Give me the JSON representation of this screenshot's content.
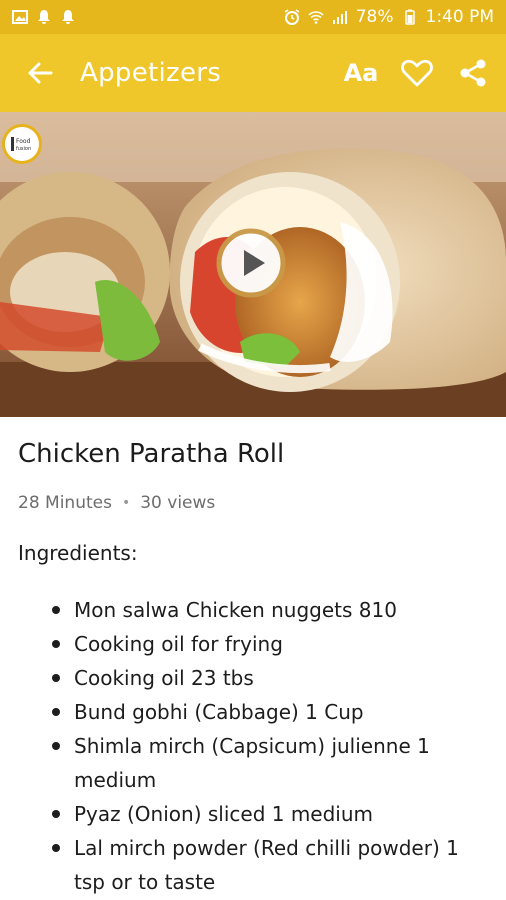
{
  "status_bar": {
    "battery": "78%",
    "time": "1:40 PM"
  },
  "app_bar": {
    "title": "Appetizers",
    "font_size_label": "Aa"
  },
  "hero": {
    "logo_text": "Food Fusion"
  },
  "recipe": {
    "title": "Chicken Paratha Roll",
    "duration": "28 Minutes",
    "views": "30 views",
    "ingredients_heading": "Ingredients:",
    "ingredients": [
      "Mon salwa Chicken nuggets 810",
      "Cooking oil for frying",
      "Cooking oil 23 tbs",
      "Bund gobhi (Cabbage) 1 Cup",
      "Shimla mirch (Capsicum) julienne 1 medium",
      "Pyaz (Onion) sliced 1 medium",
      "Lal mirch powder (Red chilli powder) 1 tsp or to taste"
    ]
  },
  "colors": {
    "app_bar": "#efc72a",
    "status_bar": "#e5b71d"
  }
}
